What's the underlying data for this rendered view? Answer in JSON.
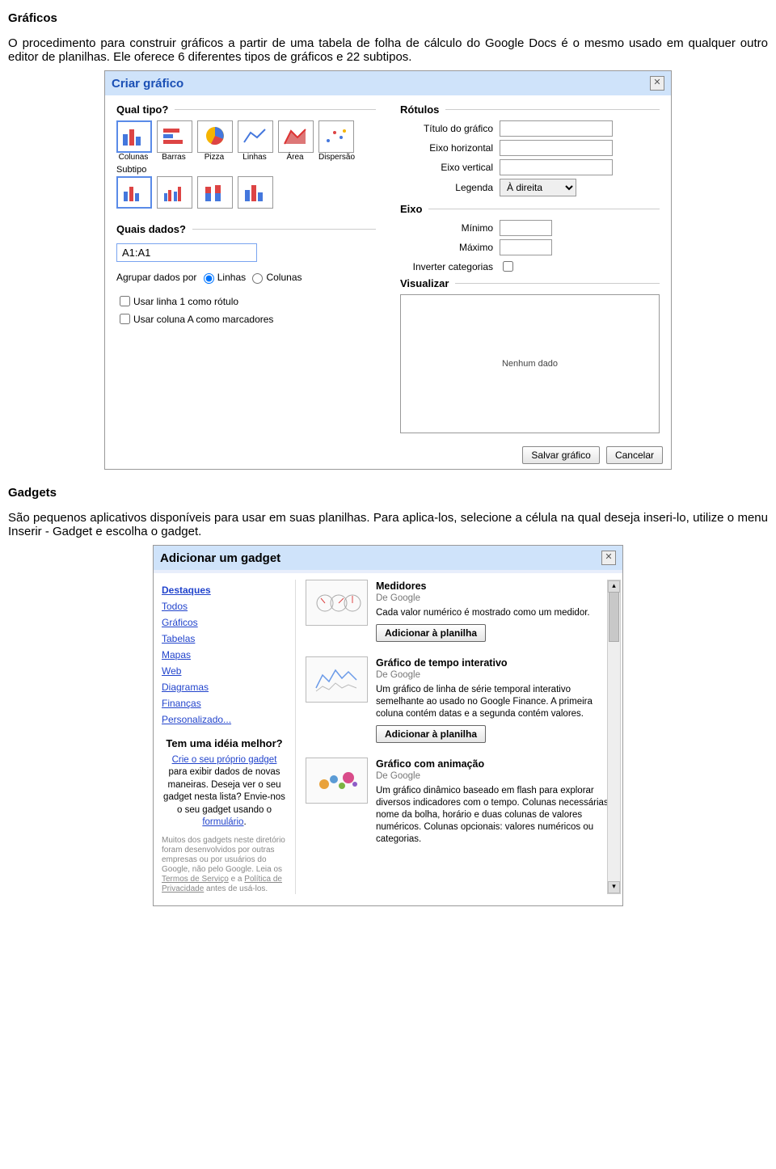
{
  "doc": {
    "h1": "Gráficos",
    "p1": "O procedimento para construir gráficos a partir de uma tabela de folha de cálculo do Google Docs é o mesmo usado em qualquer outro editor de planilhas. Ele oferece 6 diferentes tipos de gráficos e 22 subtipos.",
    "h2": "Gadgets",
    "p2": "São pequenos aplicativos disponíveis para usar em suas planilhas. Para aplica-los, selecione a célula na qual deseja inseri-lo, utilize o menu Inserir  -  Gadget e escolha o gadget."
  },
  "chartDialog": {
    "title": "Criar gráfico",
    "closeX": "✕",
    "qType": "Qual tipo?",
    "types": [
      "Colunas",
      "Barras",
      "Pizza",
      "Linhas",
      "Área",
      "Dispersão"
    ],
    "subLabel": "Subtipo",
    "qData": "Quais dados?",
    "range": "A1:A1",
    "groupBy": "Agrupar dados por",
    "optLines": "Linhas",
    "optCols": "Colunas",
    "cbRow1": "Usar linha 1 como rótulo",
    "cbColA": "Usar coluna A como marcadores",
    "rotulos": "Rótulos",
    "ftitle": "Título do gráfico",
    "fxh": "Eixo horizontal",
    "fyh": "Eixo vertical",
    "fleg": "Legenda",
    "legOpt": "À direita",
    "eixo": "Eixo",
    "min": "Mínimo",
    "max": "Máximo",
    "invert": "Inverter categorias",
    "viz": "Visualizar",
    "noData": "Nenhum dado",
    "save": "Salvar gráfico",
    "cancel": "Cancelar"
  },
  "gadgetDialog": {
    "title": "Adicionar um gadget",
    "closeX": "✕",
    "cats": [
      "Destaques",
      "Todos",
      "Gráficos",
      "Tabelas",
      "Mapas",
      "Web",
      "Diagramas",
      "Finanças",
      "Personalizado..."
    ],
    "idea": {
      "hd": "Tem uma idéia melhor?",
      "l1a": "Crie o seu próprio gadget",
      "l1b": " para exibir dados de novas maneiras. Deseja ver o seu gadget nesta lista? Envie-nos o seu gadget usando o ",
      "l2": "formulário",
      "l3": "."
    },
    "fine": {
      "t1": "Muitos dos gadgets neste diretório foram desenvolvidos por outras empresas ou por usuários do Google, não pelo Google. Leia os ",
      "a1": "Termos de Serviço",
      "t2": " e a ",
      "a2": "Política de Privacidade",
      "t3": " antes de usá-los."
    },
    "items": [
      {
        "name": "Medidores",
        "auth": "De Google",
        "desc": "Cada valor numérico é mostrado como um medidor.",
        "btn": "Adicionar à planilha"
      },
      {
        "name": "Gráfico de tempo interativo",
        "auth": "De Google",
        "desc": "Um gráfico de linha de série temporal interativo semelhante ao usado no Google Finance. A primeira coluna contém datas e a segunda contém valores.",
        "btn": "Adicionar à planilha"
      },
      {
        "name": "Gráfico com animação",
        "auth": "De Google",
        "desc": "Um gráfico dinâmico baseado em flash para explorar diversos indicadores com o tempo. Colunas necessárias: nome da bolha, horário e duas colunas de valores numéricos. Colunas opcionais: valores numéricos ou categorias.",
        "btn": ""
      }
    ]
  }
}
